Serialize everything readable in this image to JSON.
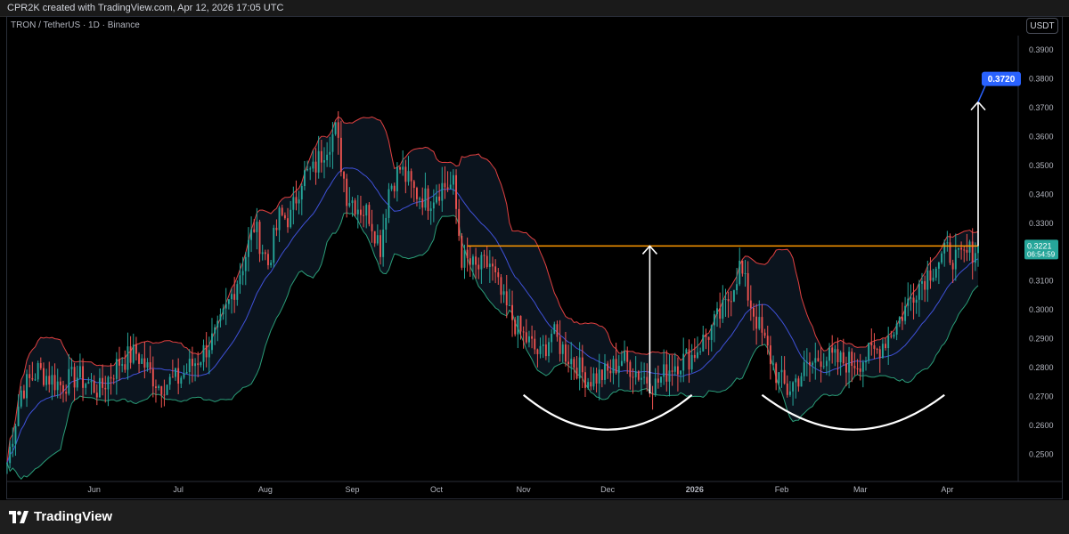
{
  "header": {
    "credit": "CPR2K created with TradingView.com, Apr 12, 2026 17:05 UTC"
  },
  "symbol": {
    "label": "TRON / TetherUS · 1D · Binance"
  },
  "currency_button": "USDT",
  "footer": {
    "brand": "TradingView"
  },
  "colors": {
    "up": "#26a69a",
    "down": "#ef5350",
    "upper_band": "#e04040",
    "lower_band": "#2a9d78",
    "basis": "#3f51d8",
    "resistance": "#ff9800",
    "target_badge": "#2962ff",
    "price_badge": "#26a69a"
  },
  "chart_data": {
    "type": "candlestick",
    "timeframe": "1D",
    "ylim": [
      0.247,
      0.395
    ],
    "y_ticks": [
      "0.3900",
      "0.3800",
      "0.3700",
      "0.3600",
      "0.3500",
      "0.3400",
      "0.3300",
      "0.3200",
      "0.3100",
      "0.3000",
      "0.2900",
      "0.2800",
      "0.2700",
      "0.2600",
      "0.2500"
    ],
    "x_ticks": [
      "Jun",
      "Jul",
      "Aug",
      "Sep",
      "Oct",
      "Nov",
      "Dec",
      "2026",
      "Feb",
      "Mar",
      "Apr"
    ],
    "x_tick_dates": [
      "2025-06-01",
      "2025-07-01",
      "2025-08-01",
      "2025-09-01",
      "2025-10-01",
      "2025-11-01",
      "2025-12-01",
      "2026-01-01",
      "2026-02-01",
      "2026-03-01",
      "2026-04-01"
    ],
    "date_range": [
      "2025-05-01",
      "2026-04-12"
    ],
    "close_anchors": [
      [
        "2025-05-01",
        0.247
      ],
      [
        "2025-05-06",
        0.272
      ],
      [
        "2025-05-12",
        0.279
      ],
      [
        "2025-05-20",
        0.274
      ],
      [
        "2025-05-26",
        0.277
      ],
      [
        "2025-06-03",
        0.272
      ],
      [
        "2025-06-10",
        0.282
      ],
      [
        "2025-06-16",
        0.285
      ],
      [
        "2025-06-24",
        0.274
      ],
      [
        "2025-07-01",
        0.276
      ],
      [
        "2025-07-08",
        0.283
      ],
      [
        "2025-07-15",
        0.292
      ],
      [
        "2025-07-20",
        0.305
      ],
      [
        "2025-07-24",
        0.316
      ],
      [
        "2025-07-28",
        0.329
      ],
      [
        "2025-08-02",
        0.316
      ],
      [
        "2025-08-06",
        0.332
      ],
      [
        "2025-08-10",
        0.332
      ],
      [
        "2025-08-14",
        0.346
      ],
      [
        "2025-08-18",
        0.348
      ],
      [
        "2025-08-22",
        0.356
      ],
      [
        "2025-08-26",
        0.362
      ],
      [
        "2025-08-30",
        0.34
      ],
      [
        "2025-09-03",
        0.336
      ],
      [
        "2025-09-07",
        0.333
      ],
      [
        "2025-09-11",
        0.322
      ],
      [
        "2025-09-14",
        0.342
      ],
      [
        "2025-09-18",
        0.349
      ],
      [
        "2025-09-23",
        0.341
      ],
      [
        "2025-09-28",
        0.338
      ],
      [
        "2025-10-03",
        0.343
      ],
      [
        "2025-10-07",
        0.343
      ],
      [
        "2025-10-10",
        0.318
      ],
      [
        "2025-10-15",
        0.314
      ],
      [
        "2025-10-20",
        0.316
      ],
      [
        "2025-10-25",
        0.302
      ],
      [
        "2025-10-31",
        0.292
      ],
      [
        "2025-11-07",
        0.284
      ],
      [
        "2025-11-11",
        0.292
      ],
      [
        "2025-11-16",
        0.285
      ],
      [
        "2025-11-24",
        0.276
      ],
      [
        "2025-12-01",
        0.278
      ],
      [
        "2025-12-06",
        0.283
      ],
      [
        "2025-12-12",
        0.278
      ],
      [
        "2025-12-18",
        0.274
      ],
      [
        "2025-12-24",
        0.281
      ],
      [
        "2025-12-31",
        0.284
      ],
      [
        "2026-01-06",
        0.292
      ],
      [
        "2026-01-12",
        0.301
      ],
      [
        "2026-01-17",
        0.315
      ],
      [
        "2026-01-21",
        0.302
      ],
      [
        "2026-01-25",
        0.291
      ],
      [
        "2026-01-30",
        0.278
      ],
      [
        "2026-02-03",
        0.272
      ],
      [
        "2026-02-08",
        0.278
      ],
      [
        "2026-02-15",
        0.284
      ],
      [
        "2026-02-22",
        0.282
      ],
      [
        "2026-02-28",
        0.282
      ],
      [
        "2026-03-07",
        0.286
      ],
      [
        "2026-03-14",
        0.295
      ],
      [
        "2026-03-21",
        0.308
      ],
      [
        "2026-03-28",
        0.316
      ],
      [
        "2026-04-01",
        0.32
      ],
      [
        "2026-04-05",
        0.317
      ],
      [
        "2026-04-12",
        0.3221
      ]
    ],
    "indicator": "Bollinger Bands",
    "resistance": {
      "price": 0.3221,
      "from": "2025-10-12",
      "to": "2026-04-12"
    },
    "measure_arrows": [
      {
        "date": "2025-12-16",
        "from": 0.271,
        "to": 0.3221
      },
      {
        "date": "2026-04-12",
        "from": 0.3221,
        "to": 0.372
      }
    ],
    "rounded_bottoms": [
      {
        "from": "2025-11-01",
        "to": "2025-12-31"
      },
      {
        "from": "2026-01-25",
        "to": "2026-03-31"
      }
    ],
    "target": "0.3720",
    "last_price": "0.3221",
    "countdown": "06:54:59"
  }
}
